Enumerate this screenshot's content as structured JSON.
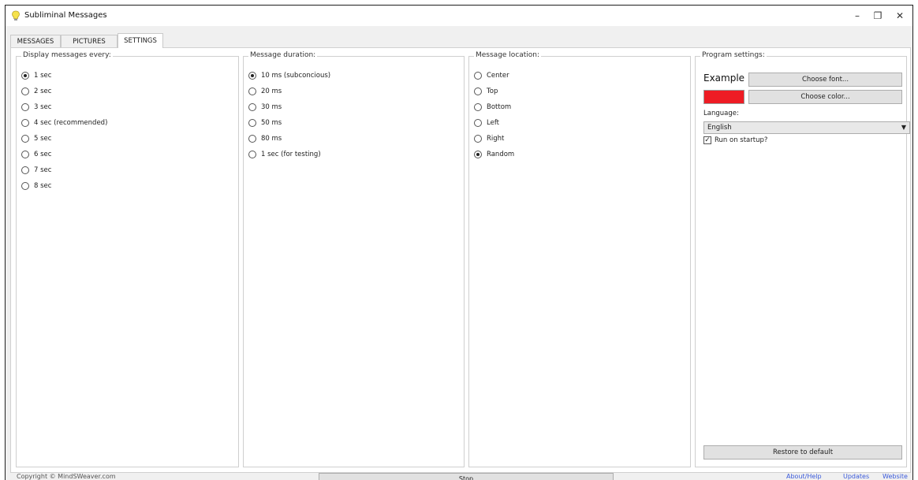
{
  "window": {
    "title": "Subliminal Messages",
    "controls": {
      "minimize": "–",
      "restore": "❐",
      "close": "✕"
    }
  },
  "tabs": [
    {
      "label": "MESSAGES",
      "active": false
    },
    {
      "label": "PICTURES",
      "active": false
    },
    {
      "label": "SETTINGS",
      "active": true
    }
  ],
  "display_every": {
    "title": "Display messages every:",
    "options": [
      {
        "label": "1 sec",
        "selected": true
      },
      {
        "label": "2 sec",
        "selected": false
      },
      {
        "label": "3 sec",
        "selected": false
      },
      {
        "label": "4 sec (recommended)",
        "selected": false
      },
      {
        "label": "5 sec",
        "selected": false
      },
      {
        "label": "6 sec",
        "selected": false
      },
      {
        "label": "7 sec",
        "selected": false
      },
      {
        "label": "8 sec",
        "selected": false
      }
    ]
  },
  "duration": {
    "title": "Message duration:",
    "options": [
      {
        "label": "10 ms (subconcious)",
        "selected": true
      },
      {
        "label": "20 ms",
        "selected": false
      },
      {
        "label": "30 ms",
        "selected": false
      },
      {
        "label": "50 ms",
        "selected": false
      },
      {
        "label": "80 ms",
        "selected": false
      },
      {
        "label": "1 sec (for testing)",
        "selected": false
      }
    ]
  },
  "location": {
    "title": "Message location:",
    "options": [
      {
        "label": "Center",
        "selected": false
      },
      {
        "label": "Top",
        "selected": false
      },
      {
        "label": "Bottom",
        "selected": false
      },
      {
        "label": "Left",
        "selected": false
      },
      {
        "label": "Right",
        "selected": false
      },
      {
        "label": "Random",
        "selected": true
      }
    ]
  },
  "program": {
    "title": "Program settings:",
    "example_text": "Example",
    "choose_font": "Choose font...",
    "choose_color": "Choose color...",
    "color_value": "#ee1c24",
    "language_label": "Language:",
    "language_value": "English",
    "run_on_startup_label": "Run on startup?",
    "run_on_startup_checked": true,
    "restore_default": "Restore to default"
  },
  "footer": {
    "copyright": "Copyright © MindSWeaver.com",
    "stop": "Stop",
    "links": [
      "About/Help",
      "Updates",
      "Website"
    ]
  }
}
